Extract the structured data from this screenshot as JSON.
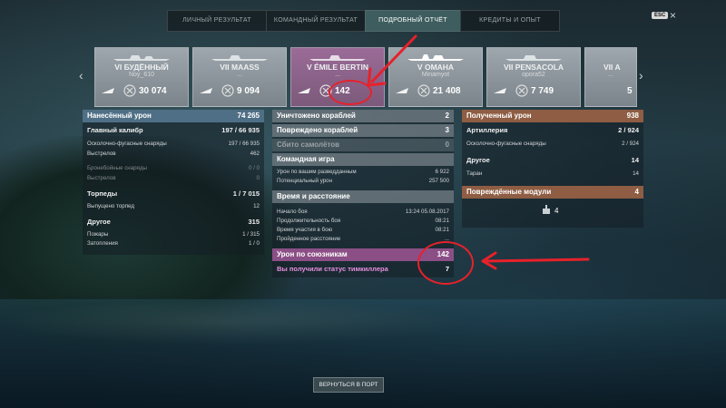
{
  "tabs": [
    {
      "label": "ЛИЧНЫЙ РЕЗУЛЬТАТ"
    },
    {
      "label": "КОМАНДНЫЙ РЕЗУЛЬТАТ"
    },
    {
      "label": "ПОДРОБНЫЙ ОТЧЁТ"
    },
    {
      "label": "КРЕДИТЫ И ОПЫТ"
    }
  ],
  "active_tab": "ПОДРОБНЫЙ ОТЧЁТ",
  "esc_label": "ESC",
  "close_glyph": "×",
  "ships": [
    {
      "tier_name": "VI БУДЁННЫЙ",
      "player": "Noy_610",
      "damage": "30 074"
    },
    {
      "tier_name": "VII MAASS",
      "player": "...",
      "damage": "9 094"
    },
    {
      "tier_name": "V ÉMILE BERTIN",
      "player": "...",
      "damage": "142",
      "selected": true
    },
    {
      "tier_name": "V OMAHA",
      "player": "Minamyot",
      "damage": "21 408"
    },
    {
      "tier_name": "VII PENSACOLA",
      "player": "opora52",
      "damage": "7 749"
    },
    {
      "tier_name": "VII A",
      "player": "...",
      "damage": "5"
    }
  ],
  "left": {
    "header": {
      "label": "Нанесённый урон",
      "value": "74 265"
    },
    "rows": [
      {
        "label": "Главный калибр",
        "value": "197 / 66 935",
        "type": "sub"
      },
      {
        "label": "Осколочно-фугасные снаряды",
        "value": "197 / 66 935",
        "type": "small"
      },
      {
        "label": "Выстрелов",
        "value": "462",
        "type": "small"
      },
      {
        "label": "Бронебойные снаряды",
        "value": "0 / 0",
        "type": "small dim"
      },
      {
        "label": "Выстрелов",
        "value": "0",
        "type": "small dim"
      },
      {
        "label": "Торпеды",
        "value": "1 / 7 015",
        "type": "sub"
      },
      {
        "label": "Выпущено торпед",
        "value": "12",
        "type": "small"
      },
      {
        "label": "Другое",
        "value": "315",
        "type": "sub"
      },
      {
        "label": "Пожары",
        "value": "1 / 315",
        "type": "small"
      },
      {
        "label": "Затопления",
        "value": "1 / 0",
        "type": "small"
      }
    ]
  },
  "middle": {
    "kills": {
      "label": "Уничтожено кораблей",
      "value": "2"
    },
    "damaged": {
      "label": "Повреждено кораблей",
      "value": "3"
    },
    "planes": {
      "label": "Сбито самолётов",
      "value": "0"
    },
    "team_header": "Командная игра",
    "team_rows": [
      {
        "label": "Урон по вашим разведданным",
        "value": "6 922"
      },
      {
        "label": "Потенциальный урон",
        "value": "257 500"
      }
    ],
    "time_header": "Время и расстояние",
    "time_rows": [
      {
        "label": "Начало боя",
        "value": "13:24  05.08.2017"
      },
      {
        "label": "Продолжительность боя",
        "value": "08:21"
      },
      {
        "label": "Время участия в бою",
        "value": "08:21"
      },
      {
        "label": "Пройденное расстояние",
        "value": "..."
      }
    ],
    "ally_header": {
      "label": "Урон по союзникам",
      "value": "142"
    },
    "teamkiller": {
      "label": "Вы получили статус тимкиллера",
      "value": "7"
    }
  },
  "right": {
    "header": {
      "label": "Полученный урон",
      "value": "938"
    },
    "rows": [
      {
        "label": "Артиллерия",
        "value": "2 / 924",
        "type": "sub"
      },
      {
        "label": "Осколочно-фугасные снаряды",
        "value": "2 / 924",
        "type": "small"
      },
      {
        "label": "Другое",
        "value": "14",
        "type": "sub"
      },
      {
        "label": "Таран",
        "value": "14",
        "type": "small"
      }
    ],
    "modules_header": {
      "label": "Повреждённые модули",
      "value": "4"
    },
    "module_count": "4"
  },
  "return_button": "ВЕРНУТЬСЯ В ПОРТ",
  "colors": {
    "annotation": "#e8212a",
    "selected_card": "#8b5a88",
    "teamkill_text": "#e98fe0"
  }
}
